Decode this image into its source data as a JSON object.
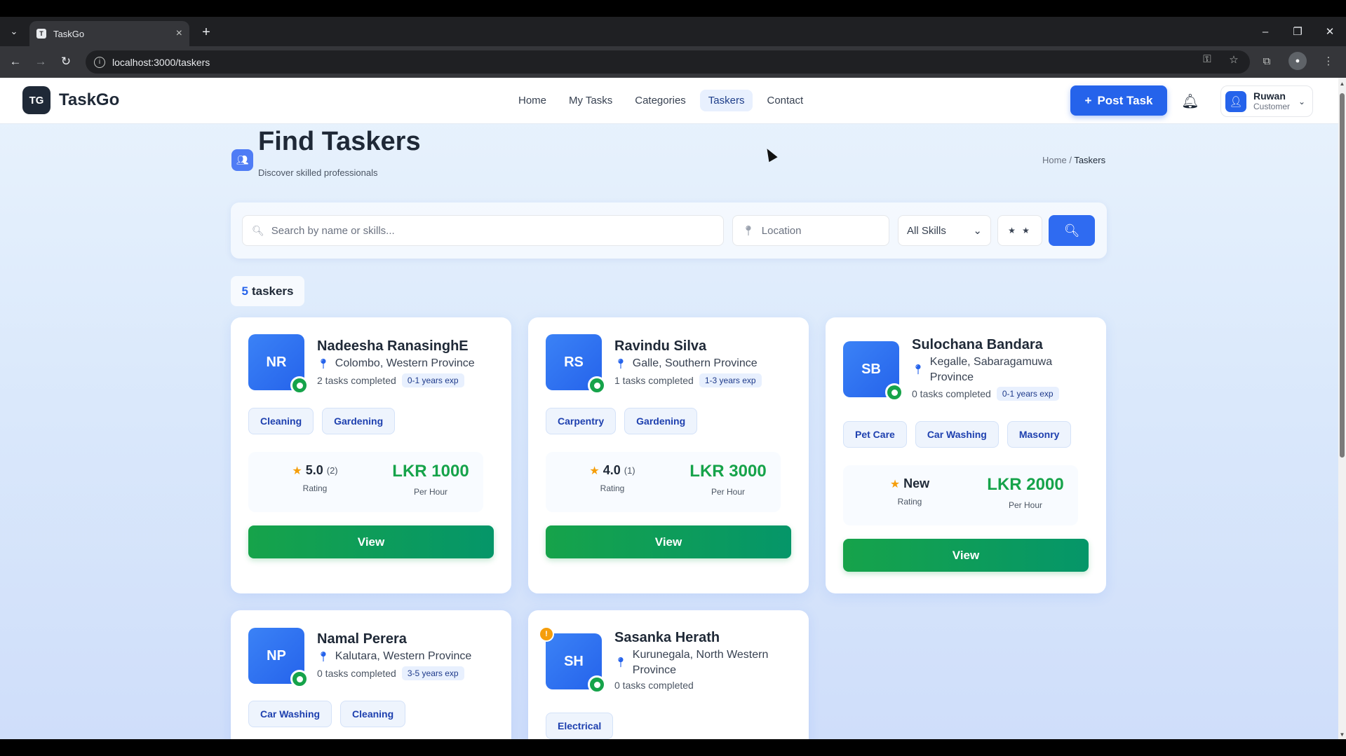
{
  "browser": {
    "tab_title": "TaskGo",
    "url": "localhost:3000/taskers",
    "icons": [
      "tab-list-icon",
      "close-icon",
      "plus-icon",
      "minimize-icon",
      "restore-icon",
      "close-window-icon",
      "back-icon",
      "forward-icon",
      "reload-icon",
      "site-info-icon",
      "password-key-icon",
      "bookmark-star-icon",
      "extensions-icon",
      "profile-icon",
      "menu-icon"
    ]
  },
  "header": {
    "logo_glyph": "TG",
    "brand": "TaskGo",
    "nav": [
      {
        "label": "Home",
        "active": false
      },
      {
        "label": "My Tasks",
        "active": false
      },
      {
        "label": "Categories",
        "active": false
      },
      {
        "label": "Taskers",
        "active": true
      },
      {
        "label": "Contact",
        "active": false
      }
    ],
    "post_task_label": "Post Task",
    "user_name": "Ruwan",
    "user_role": "Customer"
  },
  "page": {
    "title": "Find Taskers",
    "subtitle": "Discover skilled professionals",
    "breadcrumb_home": "Home",
    "breadcrumb_sep": "/",
    "breadcrumb_current": "Taskers"
  },
  "search": {
    "query_placeholder": "Search by name or skills...",
    "location_placeholder": "Location",
    "skill_selected": "All Skills",
    "rating_filter": "★ ★"
  },
  "results": {
    "count": "5",
    "count_label": "taskers"
  },
  "taskers": [
    {
      "initials": "NR",
      "name": "Nadeesha RanasinghE",
      "location": "Colombo, Western Province",
      "tasks": "2 tasks completed",
      "experience": "0-1 years exp",
      "skills": [
        "Cleaning",
        "Gardening"
      ],
      "rating": "5.0",
      "rating_count": "(2)",
      "rating_label": "Rating",
      "price": "LKR 1000",
      "price_label": "Per Hour",
      "view_label": "View"
    },
    {
      "initials": "RS",
      "name": "Ravindu Silva",
      "location": "Galle, Southern Province",
      "tasks": "1 tasks completed",
      "experience": "1-3 years exp",
      "skills": [
        "Carpentry",
        "Gardening"
      ],
      "rating": "4.0",
      "rating_count": "(1)",
      "rating_label": "Rating",
      "price": "LKR 3000",
      "price_label": "Per Hour",
      "view_label": "View"
    },
    {
      "initials": "SB",
      "name": "Sulochana Bandara",
      "location": "Kegalle, Sabaragamuwa Province",
      "tasks": "0 tasks completed",
      "experience": "0-1 years exp",
      "skills": [
        "Pet Care",
        "Car Washing",
        "Masonry"
      ],
      "rating": "New",
      "rating_count": "",
      "rating_label": "Rating",
      "price": "LKR 2000",
      "price_label": "Per Hour",
      "view_label": "View"
    },
    {
      "initials": "NP",
      "name": "Namal Perera",
      "location": "Kalutara, Western Province",
      "tasks": "0 tasks completed",
      "experience": "3-5 years exp",
      "skills": [
        "Car Washing",
        "Cleaning"
      ]
    },
    {
      "initials": "SH",
      "name": "Sasanka Herath",
      "location": "Kurunegala, North Western Province",
      "tasks": "0 tasks completed",
      "experience": "",
      "skills": [
        "Electrical"
      ]
    }
  ]
}
